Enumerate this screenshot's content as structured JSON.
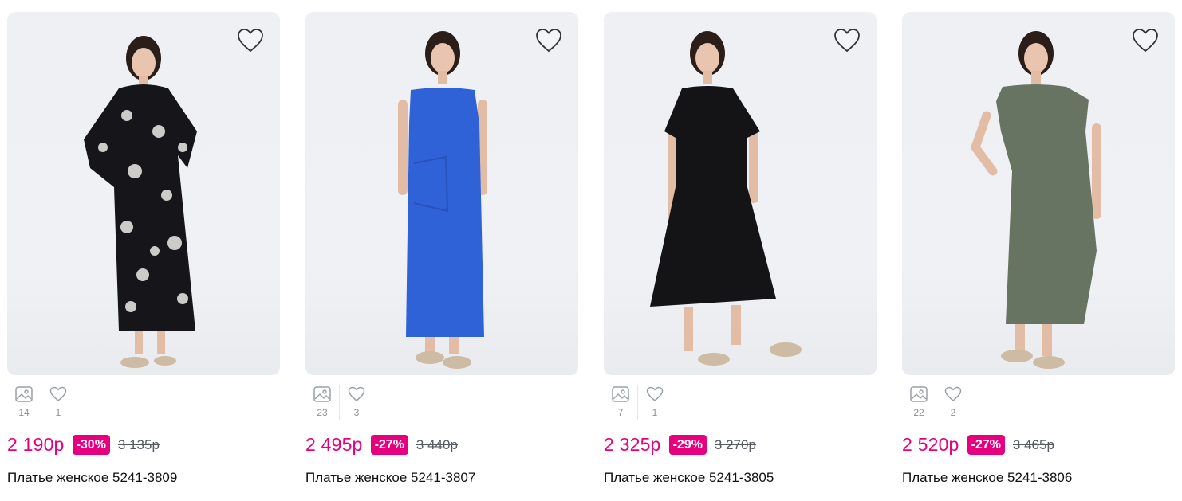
{
  "colors": {
    "accent": "#e6007e",
    "photo_bg": "#eef0f4"
  },
  "products": [
    {
      "photos_count": "14",
      "likes_count": "1",
      "price": "2 190р",
      "discount": "-30%",
      "old_price": "3 135р",
      "title": "Платье женское 5241-3809",
      "dress_color": "#16161a",
      "dress_pattern": "floral-print"
    },
    {
      "photos_count": "23",
      "likes_count": "3",
      "price": "2 495р",
      "discount": "-27%",
      "old_price": "3 440р",
      "title": "Платье женское 5241-3807",
      "dress_color": "#2f62d6",
      "dress_pattern": "solid"
    },
    {
      "photos_count": "7",
      "likes_count": "1",
      "price": "2 325р",
      "discount": "-29%",
      "old_price": "3 270р",
      "title": "Платье женское 5241-3805",
      "dress_color": "#141417",
      "dress_pattern": "solid"
    },
    {
      "photos_count": "22",
      "likes_count": "2",
      "price": "2 520р",
      "discount": "-27%",
      "old_price": "3 465р",
      "title": "Платье женское 5241-3806",
      "dress_color": "#687462",
      "dress_pattern": "solid"
    }
  ],
  "icons": {
    "favorite": "heart-outline-icon",
    "photos": "image-icon",
    "likes": "heart-small-icon"
  }
}
